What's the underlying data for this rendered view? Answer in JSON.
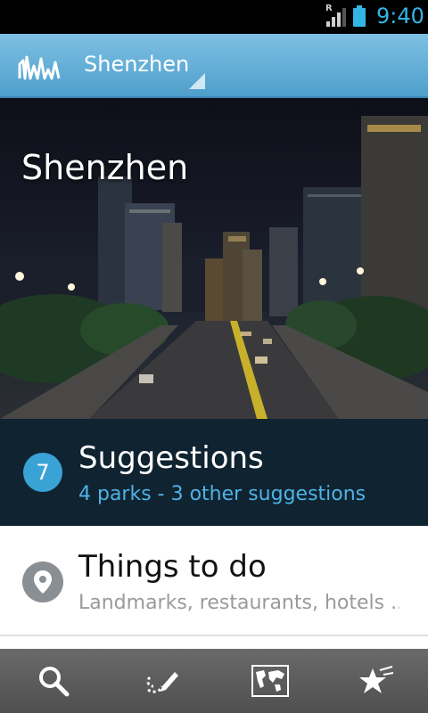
{
  "status_bar": {
    "time": "9:40",
    "roaming_indicator": "R",
    "icons": [
      "signal-icon",
      "battery-icon"
    ]
  },
  "action_bar": {
    "city": "Shenzhen",
    "icons": [
      "app-logo-icon",
      "dropdown-corner-icon"
    ]
  },
  "hero": {
    "title": "Shenzhen"
  },
  "suggestions": {
    "count": "7",
    "title": "Suggestions",
    "subtitle": "4 parks - 3 other suggestions"
  },
  "things_to_do": {
    "title": "Things to do",
    "subtitle": "Landmarks, restaurants, hotels ...",
    "icon": "map-pin-icon"
  },
  "bottom_bar": {
    "buttons": [
      {
        "icon": "search-icon"
      },
      {
        "icon": "edit-path-icon"
      },
      {
        "icon": "world-map-icon"
      },
      {
        "icon": "favorites-star-icon"
      }
    ]
  },
  "colors": {
    "action_bar": "#5aaad6",
    "accent": "#33b5e5",
    "suggestions_bg": "#0f2331",
    "badge": "#3aa3d6"
  }
}
